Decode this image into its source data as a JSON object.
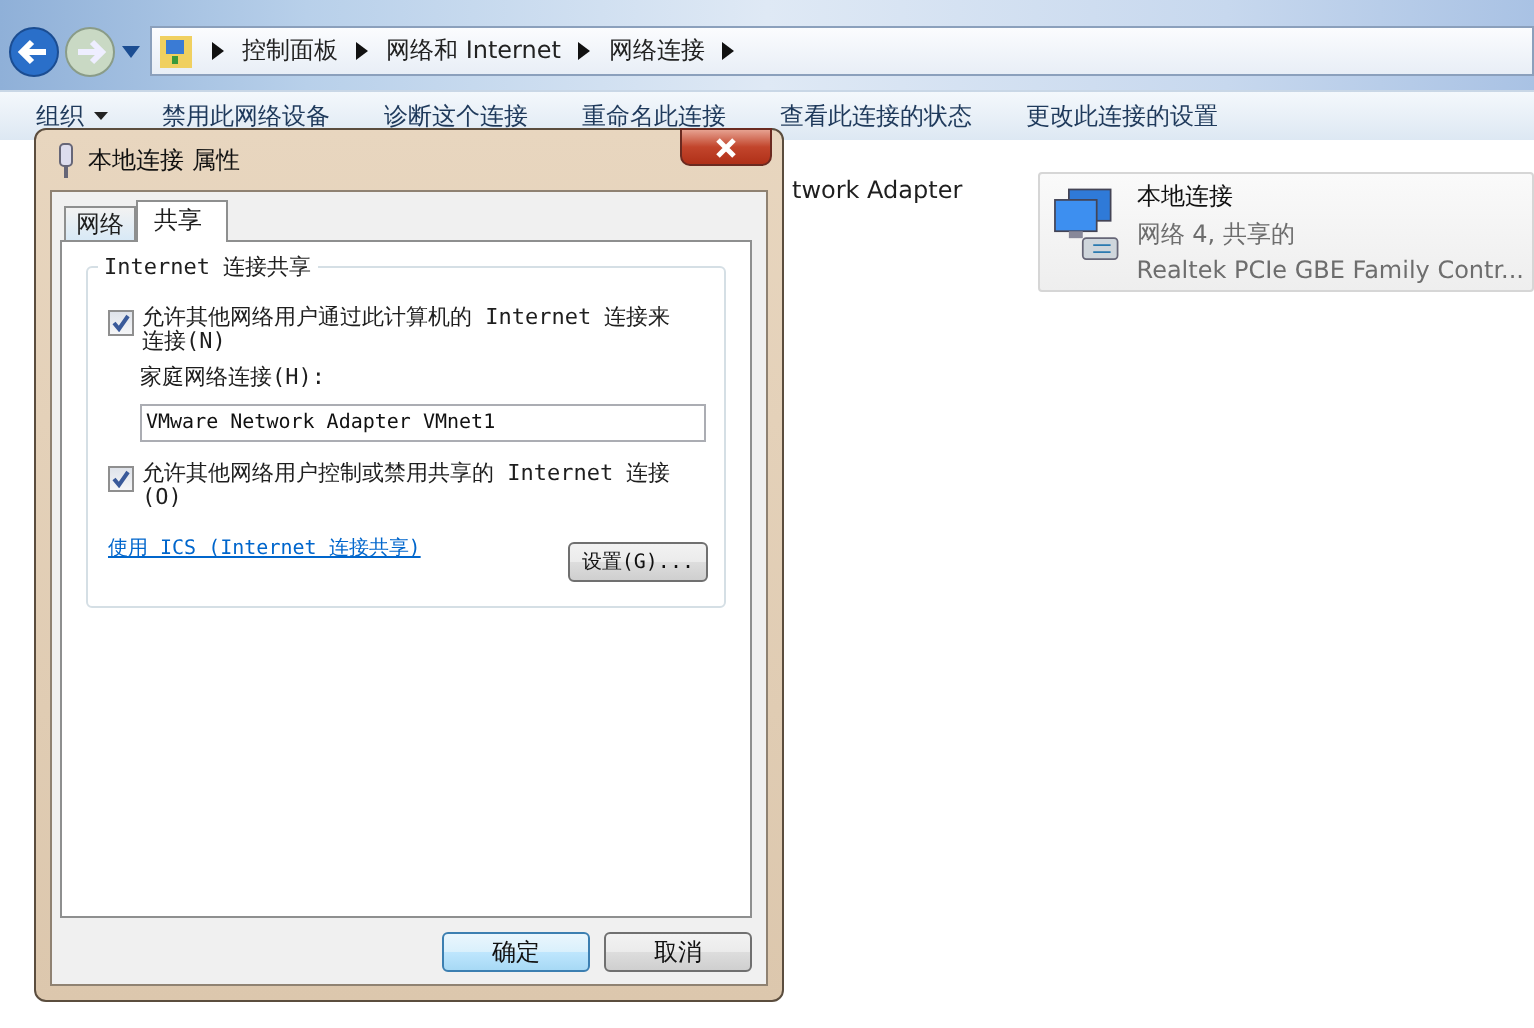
{
  "breadcrumb": [
    "控制面板",
    "网络和 Internet",
    "网络连接"
  ],
  "toolbar": [
    {
      "label": "组织",
      "kind": "menu"
    },
    {
      "label": "禁用此网络设备",
      "kind": "command"
    },
    {
      "label": "诊断这个连接",
      "kind": "command"
    },
    {
      "label": "重命名此连接",
      "kind": "command"
    },
    {
      "label": "查看此连接的状态",
      "kind": "command"
    },
    {
      "label": "更改此连接的设置",
      "kind": "command"
    }
  ],
  "partial_connection": {
    "text": "twork Adapter"
  },
  "connection": {
    "name": "本地连接",
    "status": "网络  4, 共享的",
    "device": "Realtek PCIe GBE Family Contr...",
    "selected": true
  },
  "dialog": {
    "title": "本地连接 属性",
    "tabs": [
      {
        "label": "网络",
        "selected": false
      },
      {
        "label": "共享",
        "selected": true
      }
    ],
    "group_title": "Internet 连接共享",
    "options": [
      {
        "kind": "checkbox",
        "label": "允许其他网络用户通过此计算机的 Internet 连接来连接(N)",
        "checked": true
      },
      {
        "kind": "field",
        "label": "家庭网络连接(H):",
        "value": "VMware Network Adapter VMnet1"
      },
      {
        "kind": "checkbox",
        "label": "允许其他网络用户控制或禁用共享的 Internet 连接(O)",
        "checked": true
      }
    ],
    "link": "使用 ICS (Internet 连接共享)",
    "settings_button": "设置(G)...",
    "buttons": [
      {
        "label": "确定",
        "default": true
      },
      {
        "label": "取消",
        "default": false
      }
    ]
  }
}
